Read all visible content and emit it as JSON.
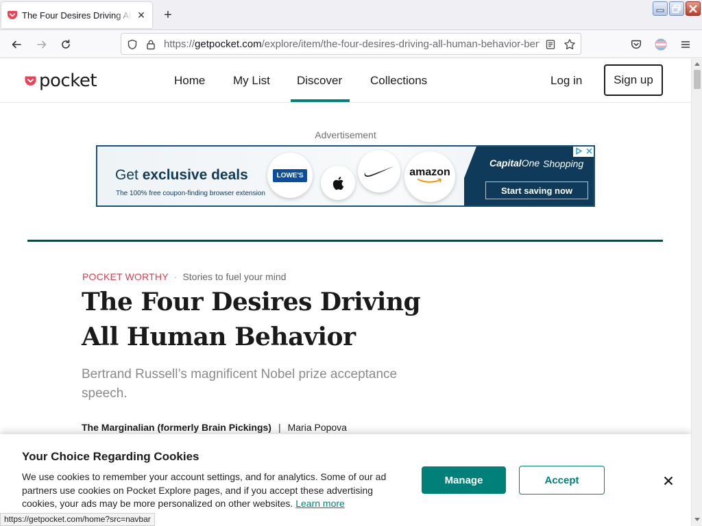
{
  "browser": {
    "tab": {
      "title": "The Four Desires Driving All Human Behavior",
      "favicon": "pocket-icon"
    },
    "url": {
      "scheme": "https://",
      "host": "getpocket.com",
      "path": "/explore/item/the-four-desires-driving-all-human-behavior-bertrand-russell"
    },
    "status_url": "https://getpocket.com/home?src=navbar"
  },
  "site": {
    "logo_text": "pocket",
    "nav": [
      {
        "label": "Home"
      },
      {
        "label": "My List"
      },
      {
        "label": "Discover",
        "active": true
      },
      {
        "label": "Collections"
      }
    ],
    "login_label": "Log in",
    "signup_label": "Sign up",
    "accent_color": "#008078",
    "brand_color": "#ef4056"
  },
  "ad": {
    "label": "Advertisement",
    "headline_prefix": "Get ",
    "headline_bold": "exclusive deals",
    "sub": "The 100% free coupon-finding browser extension",
    "logos": [
      "LOWE'S",
      "apple",
      "nike",
      "amazon"
    ],
    "cta": "Start saving now"
  },
  "article": {
    "kicker_tag": "POCKET WORTHY",
    "kicker_dot": "·",
    "kicker_desc": "Stories to fuel your mind",
    "title": "The Four Desires Driving All Human Behavior",
    "subtitle": "Bertrand Russell’s magnificent Nobel prize acceptance speech.",
    "publication": "The Marginalian (formerly Brain Pickings)",
    "byline_sep": "|",
    "author": "Maria Popova"
  },
  "cookie": {
    "title": "Your Choice Regarding Cookies",
    "body": "We use cookies to remember your account settings, and for analytics. Some of our ad partners use cookies on Pocket Explore pages, and if you accept these advertising cookies, your ads may be more personalized on other websites.",
    "learn_more": "Learn more",
    "manage": "Manage",
    "accept": "Accept"
  }
}
